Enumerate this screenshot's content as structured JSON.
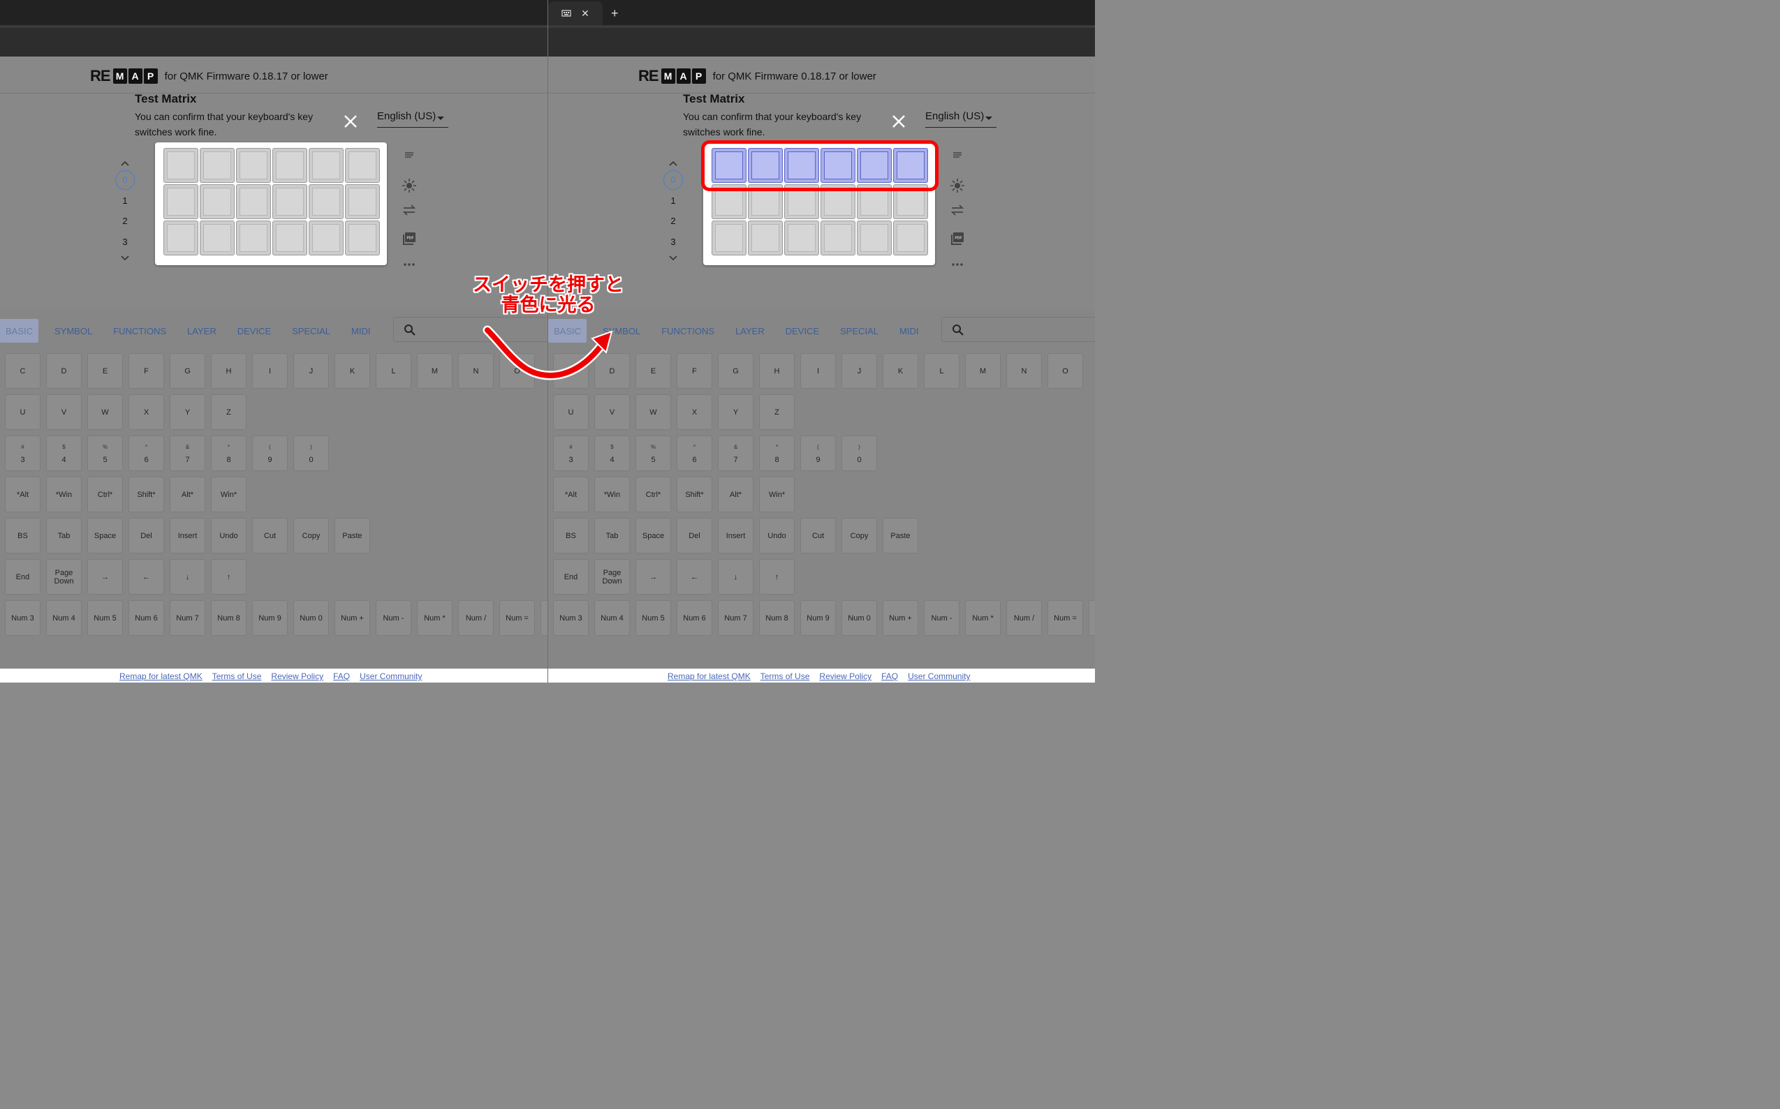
{
  "browser": {
    "new_tab_label": "+"
  },
  "header": {
    "logo_re": "RE",
    "logo_letters": [
      "M",
      "A",
      "P"
    ],
    "firmware_note": "for QMK Firmware 0.18.17 or lower"
  },
  "dialog": {
    "title": "Test Matrix",
    "description": "You can confirm that your keyboard's key switches work fine.",
    "language": "English (US)"
  },
  "layers": {
    "selected": "0",
    "items": [
      "0",
      "1",
      "2",
      "3"
    ]
  },
  "tools": [
    "menu-icon",
    "lighting-icon",
    "swap-icon",
    "pdf-icon",
    "more-icon"
  ],
  "keyboard_grid": {
    "rows": 3,
    "cols": 6,
    "lit_row_right_pane": 1
  },
  "categories": [
    "BASIC",
    "SYMBOL",
    "FUNCTIONS",
    "LAYER",
    "DEVICE",
    "SPECIAL",
    "MIDI"
  ],
  "key_rows": [
    [
      {
        "l": "C"
      },
      {
        "l": "D"
      },
      {
        "l": "E"
      },
      {
        "l": "F"
      },
      {
        "l": "G"
      },
      {
        "l": "H"
      },
      {
        "l": "I"
      },
      {
        "l": "J"
      },
      {
        "l": "K"
      },
      {
        "l": "L"
      },
      {
        "l": "M"
      },
      {
        "l": "N"
      },
      {
        "l": "O"
      }
    ],
    [
      {
        "l": "U"
      },
      {
        "l": "V"
      },
      {
        "l": "W"
      },
      {
        "l": "X"
      },
      {
        "l": "Y"
      },
      {
        "l": "Z"
      }
    ],
    [
      {
        "s": "#",
        "l": "3"
      },
      {
        "s": "$",
        "l": "4"
      },
      {
        "s": "%",
        "l": "5"
      },
      {
        "s": "^",
        "l": "6"
      },
      {
        "s": "&",
        "l": "7"
      },
      {
        "s": "*",
        "l": "8"
      },
      {
        "s": "(",
        "l": "9"
      },
      {
        "s": ")",
        "l": "0"
      }
    ],
    [
      {
        "l": "*Alt"
      },
      {
        "l": "*Win"
      },
      {
        "l": "Ctrl*"
      },
      {
        "l": "Shift*"
      },
      {
        "l": "Alt*"
      },
      {
        "l": "Win*"
      }
    ],
    [
      {
        "l": "BS"
      },
      {
        "l": "Tab"
      },
      {
        "l": "Space"
      },
      {
        "l": "Del"
      },
      {
        "l": "Insert"
      },
      {
        "l": "Undo"
      },
      {
        "l": "Cut"
      },
      {
        "l": "Copy"
      },
      {
        "l": "Paste"
      }
    ],
    [
      {
        "l": "End"
      },
      {
        "l": "Page Down"
      },
      {
        "l": "→"
      },
      {
        "l": "←"
      },
      {
        "l": "↓"
      },
      {
        "l": "↑"
      }
    ],
    [
      {
        "l": "Num 3"
      },
      {
        "l": "Num 4"
      },
      {
        "l": "Num 5"
      },
      {
        "l": "Num 6"
      },
      {
        "l": "Num 7"
      },
      {
        "l": "Num 8"
      },
      {
        "l": "Num 9"
      },
      {
        "l": "Num 0"
      },
      {
        "l": "Num +"
      },
      {
        "l": "Num -"
      },
      {
        "l": "Num *"
      },
      {
        "l": "Num /"
      },
      {
        "l": "Num ="
      },
      {
        "l": ""
      }
    ]
  ],
  "footer": {
    "links": [
      "Remap for latest QMK",
      "Terms of Use",
      "Review Policy",
      "FAQ",
      "User Community"
    ]
  },
  "annotation": {
    "line1": "スイッチを押すと",
    "line2": "青色に光る",
    "color": "#e00000"
  }
}
